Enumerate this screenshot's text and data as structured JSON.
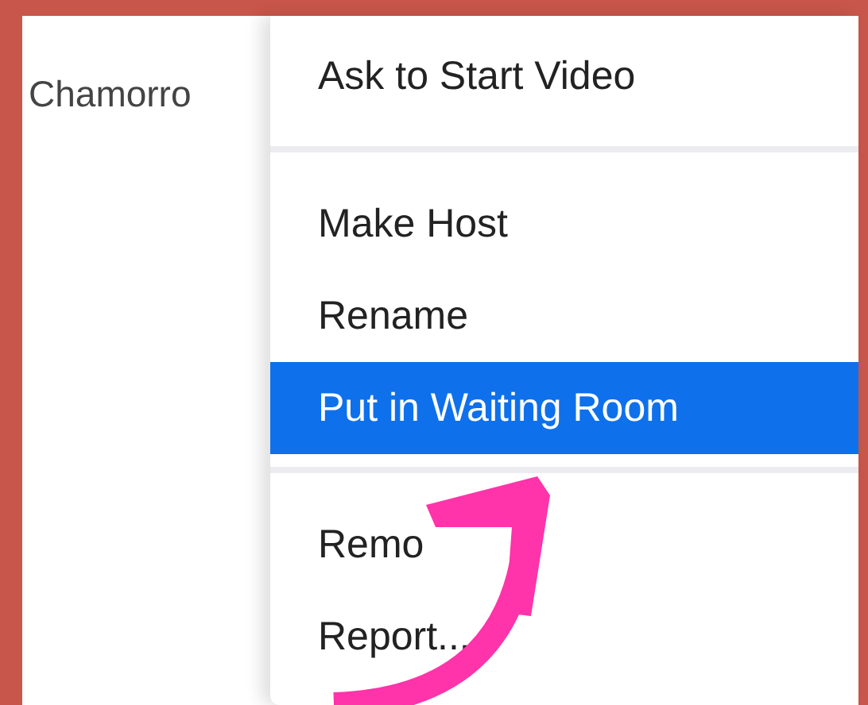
{
  "participant": {
    "name": "Chamorro"
  },
  "menu": {
    "groups": [
      {
        "items": [
          {
            "label": "Ask to Start Video",
            "selected": false
          }
        ]
      },
      {
        "items": [
          {
            "label": "Make Host",
            "selected": false
          },
          {
            "label": "Rename",
            "selected": false
          },
          {
            "label": "Put in Waiting Room",
            "selected": true
          }
        ]
      },
      {
        "items": [
          {
            "label": "Remo",
            "selected": false
          },
          {
            "label": "Report...",
            "selected": false
          }
        ]
      }
    ]
  }
}
